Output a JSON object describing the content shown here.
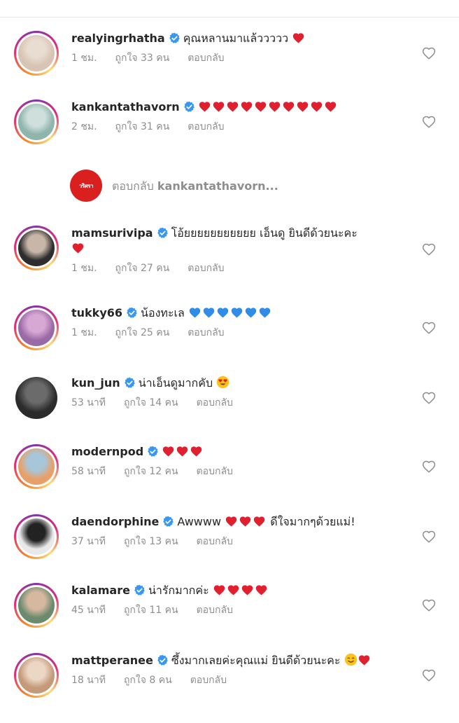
{
  "comments": [
    {
      "username": "realyingrhatha",
      "verified": true,
      "text": "คุณหลานมาแล้ววววว",
      "hearts": 1,
      "heart_color": "red",
      "extra": "",
      "time": "1 ชม.",
      "likes": "ถูกใจ 33 คน",
      "reply": "ตอบกลับ",
      "avatar_colors": [
        "#d8c4b4",
        "#e9dcd0"
      ],
      "ring": true
    },
    {
      "username": "kankantathavorn",
      "verified": true,
      "text": "",
      "hearts": 10,
      "heart_color": "red",
      "extra": "",
      "time": "2 ชม.",
      "likes": "ถูกใจ 31 คน",
      "reply": "ตอบกลับ",
      "avatar_colors": [
        "#8fb5ad",
        "#cfe0dc"
      ],
      "ring": true
    },
    {
      "username": "mamsurivipa",
      "verified": true,
      "text": "โอ้ยยยยยยยยยยย",
      "hearts": 0,
      "heart_color": "red",
      "extra": "เอ็นดู ยินดีด้วยนะคะ",
      "time": "1 ชม.",
      "likes": "ถูกใจ 27 คน",
      "reply": "ตอบกลับ",
      "avatar_colors": [
        "#2d2d2d",
        "#c8b6a8"
      ],
      "ring": true,
      "trailing_heart_line2": true
    },
    {
      "username": "tukky66",
      "verified": true,
      "text": "น้องทะเล",
      "hearts": 6,
      "heart_color": "blue",
      "extra": "",
      "time": "1 ชม.",
      "likes": "ถูกใจ 25 คน",
      "reply": "ตอบกลับ",
      "avatar_colors": [
        "#9a6aa6",
        "#d7a8d4"
      ],
      "ring": true
    },
    {
      "username": "kun_jun",
      "verified": true,
      "text": "น่าเอ็นดูมากคับ",
      "hearts": 0,
      "heart_color": "red",
      "extra": "",
      "time": "53 นาที",
      "likes": "ถูกใจ 14 คน",
      "reply": "ตอบกลับ",
      "avatar_colors": [
        "#2b2b2b",
        "#6b6b6b"
      ],
      "ring": false,
      "emoji": "heart-eyes"
    },
    {
      "username": "modernpod",
      "verified": true,
      "text": "",
      "hearts": 3,
      "heart_color": "red",
      "extra": "",
      "time": "58 นาที",
      "likes": "ถูกใจ 12 คน",
      "reply": "ตอบกลับ",
      "avatar_colors": [
        "#e8a06b",
        "#a7c7d8"
      ],
      "ring": true
    },
    {
      "username": "daendorphine",
      "verified": true,
      "text": "Awwww",
      "hearts": 3,
      "heart_color": "red",
      "extra": "ดีใจมากๆด้วยแม่!",
      "time": "37 นาที",
      "likes": "ถูกใจ 13 คน",
      "reply": "ตอบกลับ",
      "avatar_colors": [
        "#e9e9e9",
        "#222222"
      ],
      "ring": true
    },
    {
      "username": "kalamare",
      "verified": true,
      "text": "น่ารักมากค่ะ",
      "hearts": 4,
      "heart_color": "red",
      "extra": "",
      "time": "45 นาที",
      "likes": "ถูกใจ 11 คน",
      "reply": "ตอบกลับ",
      "avatar_colors": [
        "#6b8a6e",
        "#d6b8a0"
      ],
      "ring": true
    },
    {
      "username": "mattperanee",
      "verified": true,
      "text": "ซึ้งมากเลยค่ะคุณแม่ ยินดีด้วยนะคะ",
      "hearts": 1,
      "heart_color": "red",
      "extra": "",
      "time": "18 นาที",
      "likes": "ถูกใจ 8 คน",
      "reply": "ตอบกลับ",
      "avatar_colors": [
        "#c49a7a",
        "#ecd6c4"
      ],
      "ring": true,
      "emoji": "smile"
    }
  ],
  "reply_thread": {
    "label": "ตอบกลับ",
    "target": "kankantathavorn...",
    "avatar_label": "วริศรา"
  },
  "colors": {
    "verified": "#3897f0",
    "heart_red": "#e0202f",
    "heart_blue": "#2f8ce8",
    "meta": "#8e8e8e"
  }
}
